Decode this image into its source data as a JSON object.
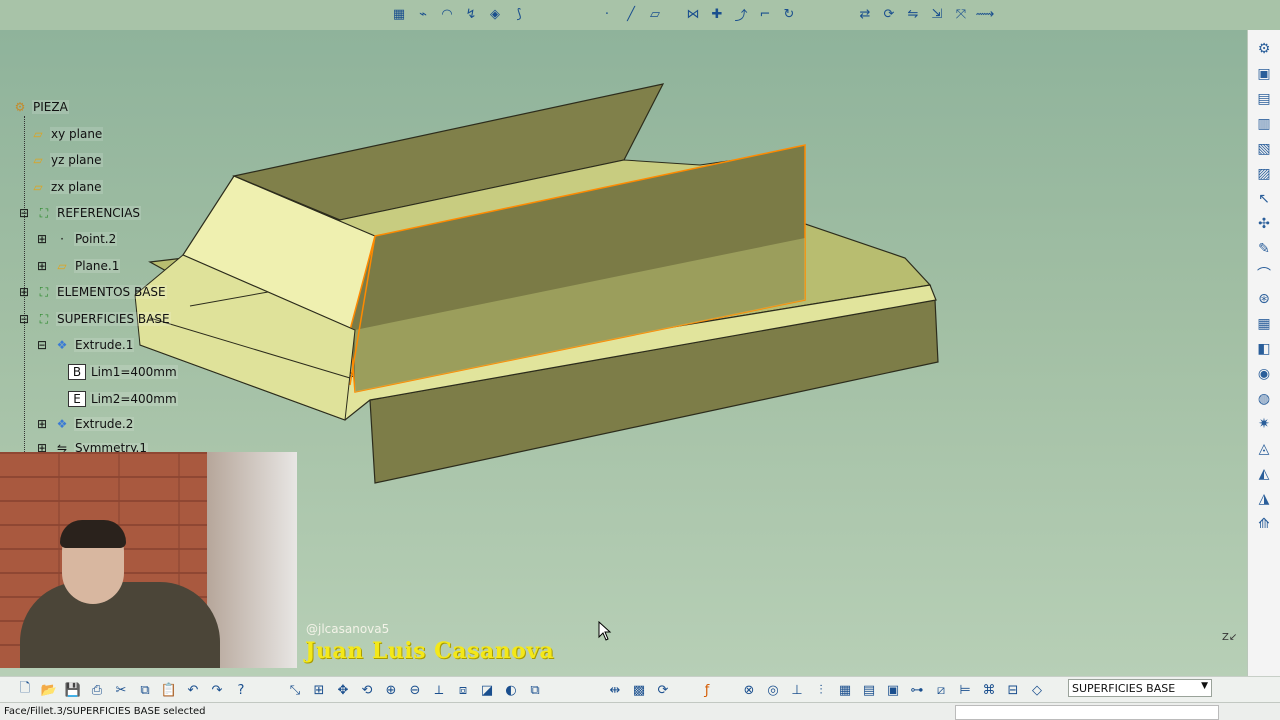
{
  "spec_tree": {
    "root": "PIEZA",
    "items": [
      {
        "label": "xy plane",
        "icon": "plane-icon"
      },
      {
        "label": "yz plane",
        "icon": "plane-icon"
      },
      {
        "label": "zx plane",
        "icon": "plane-icon"
      },
      {
        "label": "REFERENCIAS",
        "icon": "geometrical-set-icon"
      },
      {
        "label": "Point.2",
        "icon": "point-icon"
      },
      {
        "label": "Plane.1",
        "icon": "plane-icon"
      },
      {
        "label": "ELEMENTOS BASE",
        "icon": "geometrical-set-icon"
      },
      {
        "label": "SUPERFICIES BASE",
        "icon": "geometrical-set-icon"
      },
      {
        "label": "Extrude.1",
        "icon": "extrude-icon"
      },
      {
        "label": "Lim1=400mm",
        "icon": "parameter-icon"
      },
      {
        "label": "Lim2=400mm",
        "icon": "parameter-icon"
      },
      {
        "label": "Extrude.2",
        "icon": "extrude-icon"
      },
      {
        "label": "Symmetry.1",
        "icon": "symmetry-icon"
      }
    ]
  },
  "workbench_selector": {
    "value": "SUPERFICIES BASE"
  },
  "status_bar": {
    "message": "Face/Fillet.3/SUPERFICIES BASE selected"
  },
  "watermark": {
    "handle": "@jlcasanova5",
    "name": "Juan Luis Casanova"
  },
  "compass": {
    "axis_label": "Z"
  },
  "colors": {
    "viewport_bg": "#9bbba0",
    "surface_light": "#d9dc8c",
    "surface_dark": "#7f7f4a",
    "selection": "#ff8a00",
    "watermark_name": "#f4e81a"
  },
  "top_toolbar_icons": [
    "sketch-icon",
    "curve-icon",
    "surface-icon",
    "sweep-icon",
    "fill-icon",
    "blend-icon",
    "point-icon",
    "line-icon",
    "plane-icon",
    "join-icon",
    "heal-icon",
    "extract-icon",
    "fillet-icon",
    "edge-fillet-icon",
    "translate-icon",
    "rotate-icon",
    "symmetry-icon",
    "scale-icon",
    "affinity-icon",
    "extrapolate-icon"
  ],
  "bottom_toolbar_icons": [
    "new-icon",
    "open-icon",
    "save-icon",
    "print-icon",
    "cut-icon",
    "copy-icon",
    "paste-icon",
    "undo-icon",
    "redo-icon",
    "whats-this-icon",
    "select-icon",
    "fit-all-icon",
    "pan-icon",
    "rotate-view-icon",
    "zoom-in-icon",
    "zoom-out-icon",
    "normal-view-icon",
    "iso-view-icon",
    "shading-icon",
    "hide-show-icon",
    "swap-icon",
    "measure-icon",
    "apply-material-icon",
    "update-icon",
    "grid-icon",
    "snap-icon",
    "3d-compass-icon",
    "axis-icon",
    "layer-icon",
    "filter-icon",
    "properties-icon",
    "visualization-icon"
  ],
  "right_toolbar_icons": [
    "part-design-icon",
    "workbench-icon",
    "tools-icon",
    "tools-icon",
    "tools-icon",
    "tools-icon",
    "select-arrow-icon",
    "compass-icon",
    "sketcher-icon",
    "analysis-icon",
    "sketch-icon",
    "grid-icon",
    "box-icon",
    "cylinder-icon",
    "sphere-icon",
    "settings-icon",
    "sweep-icon",
    "surface-icon",
    "offset-icon",
    "measure-icon"
  ]
}
